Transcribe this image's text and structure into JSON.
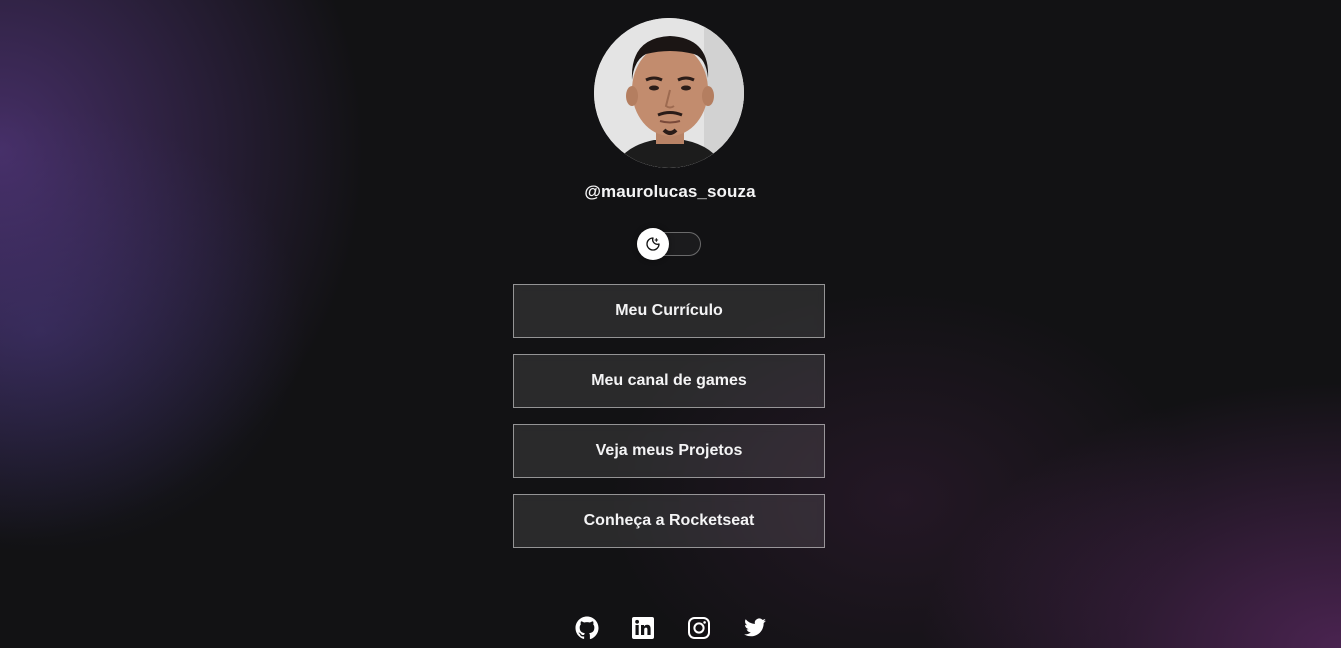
{
  "profile": {
    "username": "@maurolucas_souza",
    "avatar_icon": "profile-photo"
  },
  "theme_switch": {
    "icon": "moon-icon",
    "state": "dark"
  },
  "links": [
    {
      "label": "Meu Currículo"
    },
    {
      "label": "Meu canal de games"
    },
    {
      "label": "Veja meus Projetos"
    },
    {
      "label": "Conheça a Rocketseat"
    }
  ],
  "social": [
    {
      "icon": "github-icon"
    },
    {
      "icon": "linkedin-icon"
    },
    {
      "icon": "instagram-icon"
    },
    {
      "icon": "twitter-icon"
    }
  ],
  "colors": {
    "background": "#121214",
    "text": "#f4f4f5",
    "accent_purple": "#7046aa"
  }
}
